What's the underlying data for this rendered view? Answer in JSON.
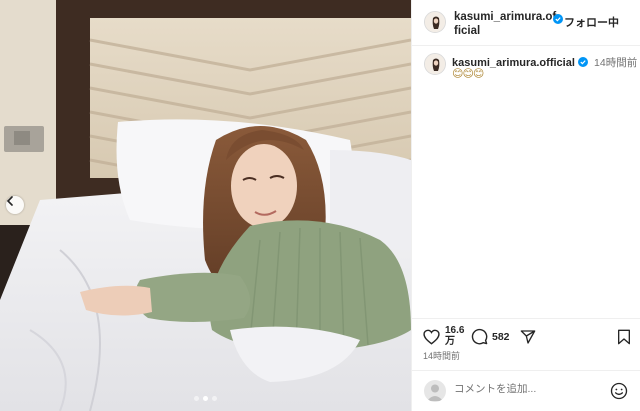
{
  "post": {
    "username": "kasumi_arimura.official",
    "follow_status": "フォロー中",
    "caption_text": "😊😊😊",
    "caption_time": "14時間前",
    "likes": "16.6万",
    "likes_line1": "16.6",
    "likes_line2": "万",
    "comments": "582",
    "posted_ago": "14時間前"
  },
  "comment_box": {
    "placeholder": "コメントを追加..."
  },
  "carousel": {
    "current": 1,
    "total": 3
  },
  "icons": {
    "verified": "verified-badge-icon",
    "like": "heart-icon",
    "comment": "comment-bubble-icon",
    "share": "paper-plane-icon",
    "save": "bookmark-icon",
    "emoji": "emoji-smiley-icon",
    "prev": "chevron-left-icon"
  },
  "colors": {
    "verified_blue": "#0095f6",
    "text": "#262626",
    "secondary_text": "#737373",
    "divider": "#efefef"
  }
}
